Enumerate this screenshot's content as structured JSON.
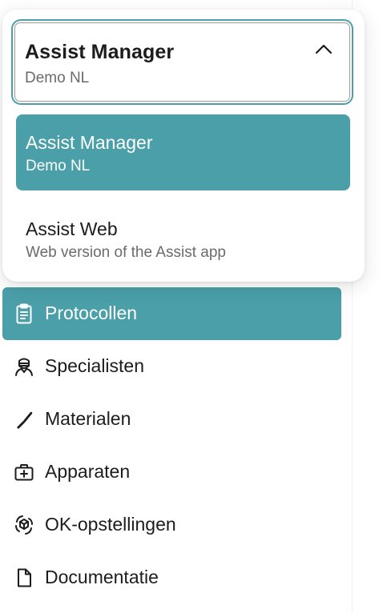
{
  "selector": {
    "title": "Assist Manager",
    "subtitle": "Demo NL",
    "expanded": true,
    "options": [
      {
        "title": "Assist Manager",
        "subtitle": "Demo NL",
        "selected": true
      },
      {
        "title": "Assist Web",
        "subtitle": "Web version of the Assist app",
        "selected": false
      }
    ]
  },
  "nav": {
    "items": [
      {
        "label": "Protocollen",
        "icon": "clipboard-icon",
        "active": true
      },
      {
        "label": "Specialisten",
        "icon": "surgeon-icon",
        "active": false
      },
      {
        "label": "Materialen",
        "icon": "scalpel-icon",
        "active": false
      },
      {
        "label": "Apparaten",
        "icon": "medical-kit-icon",
        "active": false
      },
      {
        "label": "OK-opstellingen",
        "icon": "cube-cycle-icon",
        "active": false
      },
      {
        "label": "Documentatie",
        "icon": "document-icon",
        "active": false
      }
    ]
  },
  "colors": {
    "accent": "#4a9fa8",
    "text": "#1c1c1c",
    "muted": "#6b6b6b"
  }
}
